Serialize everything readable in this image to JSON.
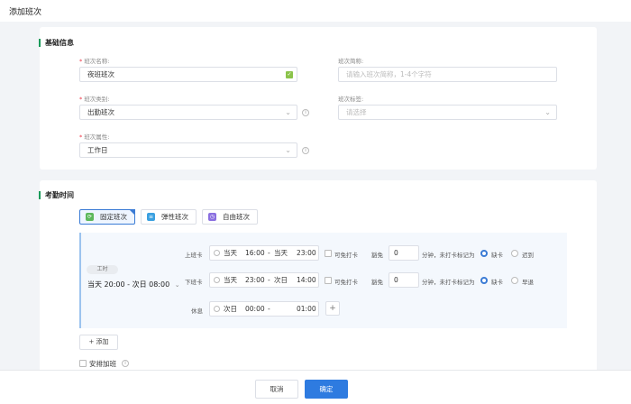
{
  "header": {
    "title": "添加班次"
  },
  "basic": {
    "section_title": "基础信息",
    "shift_name": {
      "label": "班次名称:",
      "value": "夜班班次"
    },
    "shift_abbr": {
      "label": "班次简称:",
      "placeholder": "请输入班次简称，1-4个字符"
    },
    "shift_category": {
      "label": "班次类别:",
      "value": "出勤班次"
    },
    "shift_tag": {
      "label": "班次标签:",
      "placeholder": "请选择"
    },
    "shift_attr": {
      "label": "班次属性:",
      "value": "工作日"
    }
  },
  "attendance": {
    "section_title": "考勤时间",
    "tabs": [
      {
        "label": "固定班次",
        "active": true,
        "color": "#5cb85c"
      },
      {
        "label": "弹性班次",
        "active": false,
        "color": "#3aa0e0"
      },
      {
        "label": "自由班次",
        "active": false,
        "color": "#8a6fe0"
      }
    ],
    "work_tag": "工时",
    "work_time": "当天 20:00  -  次日 08:00",
    "rows": {
      "clock_in": {
        "label": "上班卡",
        "day1": "当天",
        "time1": "16:00",
        "day2": "当天",
        "time2": "23:00",
        "optional": "可免打卡",
        "grace_prefix": "豁免",
        "grace_value": "0",
        "grace_suffix": "分钟，未打卡标记为",
        "opt1": "缺卡",
        "opt2": "迟到"
      },
      "clock_out": {
        "label": "下班卡",
        "day1": "当天",
        "time1": "23:00",
        "day2": "次日",
        "time2": "14:00",
        "optional": "可免打卡",
        "grace_prefix": "豁免",
        "grace_value": "0",
        "grace_suffix": "分钟，未打卡标记为",
        "opt1": "缺卡",
        "opt2": "早退"
      },
      "rest": {
        "label": "休息",
        "day1": "次日",
        "time1": "00:00",
        "time2": "01:00"
      }
    },
    "add_label": "+ 添加",
    "overtime_label": "安排加班"
  },
  "footer": {
    "cancel": "取消",
    "confirm": "确定"
  },
  "colors": {
    "primary": "#2e7be0",
    "accent_green": "#1a9b5a"
  }
}
